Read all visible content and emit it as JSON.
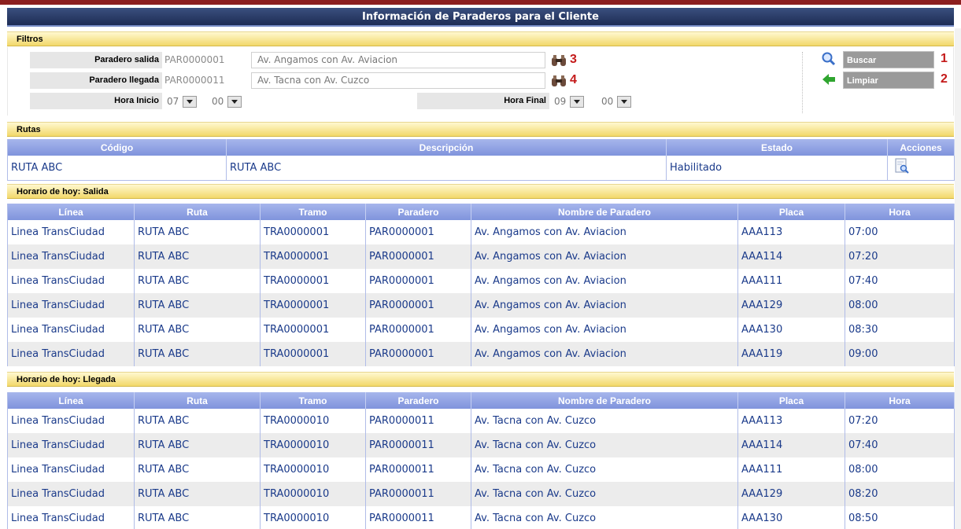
{
  "window": {
    "title": "Información de Paraderos para el Cliente"
  },
  "filters": {
    "header": "Filtros",
    "salida": {
      "label": "Paradero salida",
      "code": "PAR0000001",
      "name": "Av. Angamos con Av. Aviacion",
      "marker": "3"
    },
    "llegada": {
      "label": "Paradero llegada",
      "code": "PAR0000011",
      "name": "Av. Tacna con Av. Cuzco",
      "marker": "4"
    },
    "hora_inicio": {
      "label": "Hora Inicio",
      "hh": "07",
      "mm": "00"
    },
    "hora_final": {
      "label": "Hora Final",
      "hh": "09",
      "mm": "00"
    },
    "buscar": {
      "label": "Buscar",
      "marker": "1",
      "icon": "magnifier-icon"
    },
    "limpiar": {
      "label": "Limpiar",
      "marker": "2",
      "icon": "arrow-left-icon"
    }
  },
  "rutas": {
    "header": "Rutas",
    "columns": [
      "Código",
      "Descripción",
      "Estado",
      "Acciones"
    ],
    "rows": [
      {
        "codigo": "RUTA ABC",
        "descripcion": "RUTA ABC",
        "estado": "Habilitado",
        "action_icon": "view-document-icon"
      }
    ]
  },
  "salida": {
    "header": "Horario de hoy: Salida",
    "columns": [
      "Línea",
      "Ruta",
      "Tramo",
      "Paradero",
      "Nombre de Paradero",
      "Placa",
      "Hora"
    ],
    "rows": [
      [
        "Linea TransCiudad",
        "RUTA ABC",
        "TRA0000001",
        "PAR0000001",
        "Av. Angamos con Av. Aviacion",
        "AAA113",
        "07:00"
      ],
      [
        "Linea TransCiudad",
        "RUTA ABC",
        "TRA0000001",
        "PAR0000001",
        "Av. Angamos con Av. Aviacion",
        "AAA114",
        "07:20"
      ],
      [
        "Linea TransCiudad",
        "RUTA ABC",
        "TRA0000001",
        "PAR0000001",
        "Av. Angamos con Av. Aviacion",
        "AAA111",
        "07:40"
      ],
      [
        "Linea TransCiudad",
        "RUTA ABC",
        "TRA0000001",
        "PAR0000001",
        "Av. Angamos con Av. Aviacion",
        "AAA129",
        "08:00"
      ],
      [
        "Linea TransCiudad",
        "RUTA ABC",
        "TRA0000001",
        "PAR0000001",
        "Av. Angamos con Av. Aviacion",
        "AAA130",
        "08:30"
      ],
      [
        "Linea TransCiudad",
        "RUTA ABC",
        "TRA0000001",
        "PAR0000001",
        "Av. Angamos con Av. Aviacion",
        "AAA119",
        "09:00"
      ]
    ]
  },
  "llegada": {
    "header": "Horario de hoy: Llegada",
    "columns": [
      "Línea",
      "Ruta",
      "Tramo",
      "Paradero",
      "Nombre de Paradero",
      "Placa",
      "Hora"
    ],
    "rows": [
      [
        "Linea TransCiudad",
        "RUTA ABC",
        "TRA0000010",
        "PAR0000011",
        "Av. Tacna con Av. Cuzco",
        "AAA113",
        "07:20"
      ],
      [
        "Linea TransCiudad",
        "RUTA ABC",
        "TRA0000010",
        "PAR0000011",
        "Av. Tacna con Av. Cuzco",
        "AAA114",
        "07:40"
      ],
      [
        "Linea TransCiudad",
        "RUTA ABC",
        "TRA0000010",
        "PAR0000011",
        "Av. Tacna con Av. Cuzco",
        "AAA111",
        "08:00"
      ],
      [
        "Linea TransCiudad",
        "RUTA ABC",
        "TRA0000010",
        "PAR0000011",
        "Av. Tacna con Av. Cuzco",
        "AAA129",
        "08:20"
      ],
      [
        "Linea TransCiudad",
        "RUTA ABC",
        "TRA0000010",
        "PAR0000011",
        "Av. Tacna con Av. Cuzco",
        "AAA130",
        "08:50"
      ]
    ]
  },
  "colors": {
    "title_bg": "#1e2d55",
    "header_gold": "#f2d86a",
    "table_header": "#8fa0e2",
    "marker_red": "#c41a1a",
    "link_blue": "#1a3a8a"
  }
}
